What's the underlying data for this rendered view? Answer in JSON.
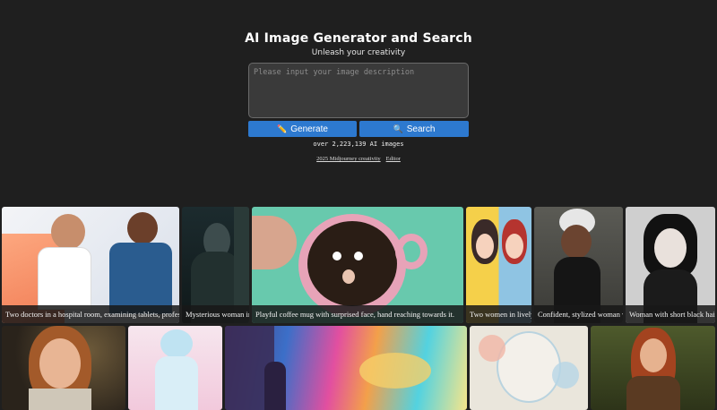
{
  "header": {
    "title": "AI Image Generator and Search",
    "subtitle": "Unleash your creativity"
  },
  "prompt": {
    "placeholder": "Please input your image description",
    "value": ""
  },
  "buttons": {
    "generate_label": "Generate",
    "search_label": "Search",
    "generate_icon": "pencil-icon",
    "search_icon": "magnifier-icon"
  },
  "stats": {
    "count_text": "over 2,223,139 AI images"
  },
  "links": {
    "creativity": "2025 Midjourney creativity",
    "editor": "Editor"
  },
  "gallery": {
    "row1": [
      {
        "caption": "Two doctors in a hospital room, examining tablets, profess"
      },
      {
        "caption": "Mysterious woman in"
      },
      {
        "caption": "Playful coffee mug with surprised face, hand reaching towards it."
      },
      {
        "caption": "Two women in lively"
      },
      {
        "caption": "Confident, stylized woman w"
      },
      {
        "caption": "Woman with short black hair"
      }
    ]
  },
  "colors": {
    "background": "#1f1f1f",
    "button": "#2d79cf",
    "input_bg": "#3a3a3a"
  }
}
